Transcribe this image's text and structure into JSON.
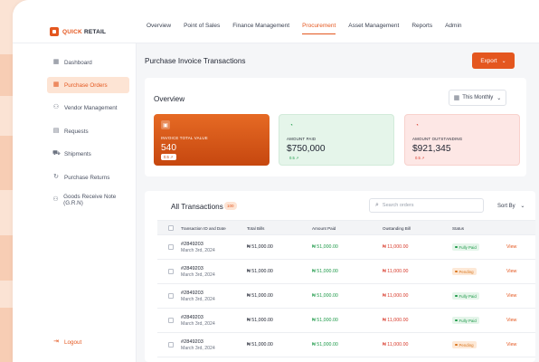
{
  "brand": {
    "name_accent": "QUICK",
    "name_rest": "RETAIL",
    "accent_color": "#e4571f"
  },
  "nav": {
    "items": [
      "Overview",
      "Point of Sales",
      "Finance Management",
      "Procurement",
      "Asset Management",
      "Reports",
      "Admin"
    ],
    "active": "Procurement"
  },
  "sidebar": {
    "items": [
      {
        "label": "Dashboard",
        "icon": "grid-icon"
      },
      {
        "label": "Purchase Orders",
        "icon": "grid-icon",
        "active": true
      },
      {
        "label": "Vendor Management",
        "icon": "users-icon"
      },
      {
        "label": "Requests",
        "icon": "document-icon"
      },
      {
        "label": "Shipments",
        "icon": "truck-icon"
      },
      {
        "label": "Purchase Returns",
        "icon": "refresh-icon"
      },
      {
        "label": "Goods Receive Note (G.R.N)",
        "icon": "users-icon"
      }
    ],
    "logout": "Logout"
  },
  "header": {
    "title": "Purchase Invoice Transactions",
    "export_label": "Export"
  },
  "overview": {
    "title": "Overview",
    "period": "This Monthly",
    "cards": [
      {
        "label": "INVOICE TOTAL VALUE",
        "value": "540",
        "badge": "0.5 ↗"
      },
      {
        "label": "AMOUNT PAID",
        "value": "$750,000",
        "badge": "0.5 ↗"
      },
      {
        "label": "AMOUNT OUTSTANDING",
        "value": "$921,345",
        "badge": "0.5 ↗"
      }
    ]
  },
  "transactions": {
    "title": "All Transactions",
    "count": "100",
    "search_placeholder": "Search orders",
    "sort_label": "Sort By",
    "columns": [
      "Transaction ID and Date",
      "Total Bills",
      "Amount Paid",
      "Oustanding Bill",
      "Status"
    ],
    "rows": [
      {
        "id": "#2849203",
        "date": "March 3rd, 2024",
        "total": "₦ 51,000.00",
        "paid": "₦ 51,000.00",
        "outstanding": "₦ 11,000.00",
        "status": "Fully Paid",
        "action": "View"
      },
      {
        "id": "#2849203",
        "date": "March 3rd, 2024",
        "total": "₦ 51,000.00",
        "paid": "₦ 51,000.00",
        "outstanding": "₦ 11,000.00",
        "status": "Pending",
        "action": "View"
      },
      {
        "id": "#2849203",
        "date": "March 3rd, 2024",
        "total": "₦ 51,000.00",
        "paid": "₦ 51,000.00",
        "outstanding": "₦ 11,000.00",
        "status": "Fully Paid",
        "action": "View"
      },
      {
        "id": "#2849203",
        "date": "March 3rd, 2024",
        "total": "₦ 51,000.00",
        "paid": "₦ 51,000.00",
        "outstanding": "₦ 11,000.00",
        "status": "Fully Paid",
        "action": "View"
      },
      {
        "id": "#2849203",
        "date": "March 3rd, 2024",
        "total": "₦ 51,000.00",
        "paid": "₦ 51,000.00",
        "outstanding": "₦ 11,000.00",
        "status": "Pending",
        "action": "View"
      }
    ]
  }
}
